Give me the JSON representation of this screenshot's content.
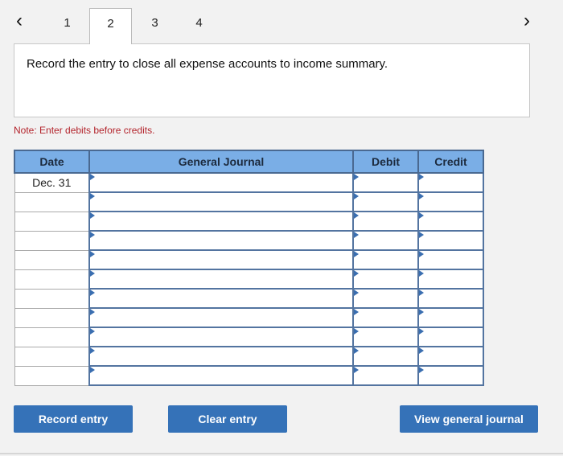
{
  "navigation": {
    "prev_icon": "chevron-left-icon",
    "next_icon": "chevron-right-icon",
    "prev_glyph": "‹",
    "next_glyph": "›",
    "tabs": [
      {
        "label": "1",
        "active": false
      },
      {
        "label": "2",
        "active": true
      },
      {
        "label": "3",
        "active": false
      },
      {
        "label": "4",
        "active": false
      }
    ]
  },
  "prompt": {
    "text": "Record the entry to close all expense accounts to income summary."
  },
  "note": "Note: Enter debits before credits.",
  "journal": {
    "headers": {
      "date": "Date",
      "general_journal": "General Journal",
      "debit": "Debit",
      "credit": "Credit"
    },
    "rows": [
      {
        "date": "Dec. 31",
        "account": "",
        "debit": "",
        "credit": ""
      },
      {
        "date": "",
        "account": "",
        "debit": "",
        "credit": ""
      },
      {
        "date": "",
        "account": "",
        "debit": "",
        "credit": ""
      },
      {
        "date": "",
        "account": "",
        "debit": "",
        "credit": ""
      },
      {
        "date": "",
        "account": "",
        "debit": "",
        "credit": ""
      },
      {
        "date": "",
        "account": "",
        "debit": "",
        "credit": ""
      },
      {
        "date": "",
        "account": "",
        "debit": "",
        "credit": ""
      },
      {
        "date": "",
        "account": "",
        "debit": "",
        "credit": ""
      },
      {
        "date": "",
        "account": "",
        "debit": "",
        "credit": ""
      },
      {
        "date": "",
        "account": "",
        "debit": "",
        "credit": ""
      },
      {
        "date": "",
        "account": "",
        "debit": "",
        "credit": ""
      }
    ]
  },
  "buttons": {
    "record": "Record entry",
    "clear": "Clear entry",
    "view": "View general journal"
  },
  "colors": {
    "header_bg": "#7aaee6",
    "button_bg": "#3572b8",
    "note_text": "#b3232b"
  }
}
